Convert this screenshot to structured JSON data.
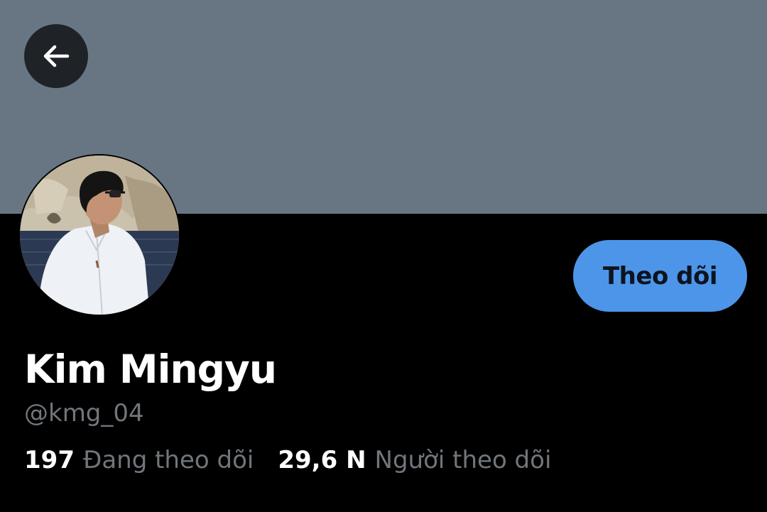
{
  "colors": {
    "banner": "#687684",
    "background": "#000000",
    "follow_button": "#4d95e8",
    "secondary_text": "#71767b"
  },
  "header": {
    "back_icon": "arrow-left-icon"
  },
  "profile": {
    "display_name": "Kim Mingyu",
    "handle": "@kmg_04",
    "follow_label": "Theo dõi",
    "avatar": "profile-photo"
  },
  "stats": {
    "following_count": "197",
    "following_label": "Đang theo dõi",
    "followers_count": "29,6 N",
    "followers_label": "Người theo dõi"
  }
}
